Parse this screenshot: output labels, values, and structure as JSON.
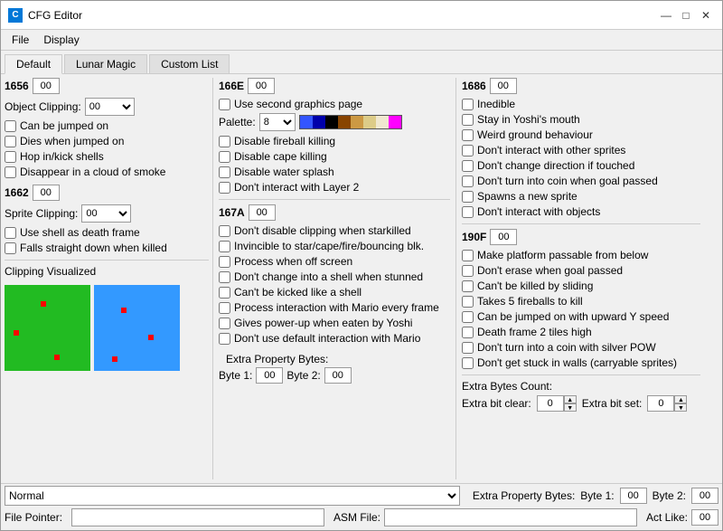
{
  "window": {
    "title": "CFG Editor",
    "icon": "C"
  },
  "titleControls": {
    "minimize": "—",
    "maximize": "□",
    "close": "✕"
  },
  "menuBar": {
    "items": [
      "File",
      "Display"
    ]
  },
  "tabs": {
    "items": [
      "Default",
      "Lunar Magic",
      "Custom List"
    ],
    "active": 0
  },
  "col1": {
    "hex1": {
      "label": "1656",
      "value": "00"
    },
    "objectClipping": {
      "label": "Object Clipping:",
      "value": "00"
    },
    "checkboxes1": [
      {
        "label": "Can be jumped on",
        "checked": false
      },
      {
        "label": "Dies when jumped on",
        "checked": false
      },
      {
        "label": "Hop in/kick shells",
        "checked": false
      },
      {
        "label": "Disappear in a cloud of smoke",
        "checked": false
      }
    ],
    "hex2": {
      "label": "1662",
      "value": "00"
    },
    "spriteClipping": {
      "label": "Sprite Clipping:",
      "value": "00"
    },
    "checkboxes2": [
      {
        "label": "Use shell as death frame",
        "checked": false
      },
      {
        "label": "Falls straight down when killed",
        "checked": false
      }
    ],
    "clippingLabel": "Clipping Visualized",
    "normalLabel": "Normal",
    "filePointerLabel": "File Pointer:",
    "asmFileLabel": "ASM File:"
  },
  "col2": {
    "hex1": {
      "label": "166E",
      "value": "00"
    },
    "checkboxUseSecond": {
      "label": "Use second graphics page",
      "checked": false
    },
    "palette": {
      "label": "Palette:",
      "value": "8",
      "colors": [
        "#3355ff",
        "#0000aa",
        "#000000",
        "#aa5500",
        "#d4a060",
        "#e8c880",
        "#f8f0d0",
        "#ff00ff"
      ]
    },
    "checkboxes": [
      {
        "label": "Disable fireball killing",
        "checked": false
      },
      {
        "label": "Disable cape killing",
        "checked": false
      },
      {
        "label": "Disable water splash",
        "checked": false
      },
      {
        "label": "Don't interact with Layer 2",
        "checked": false
      }
    ],
    "hex2": {
      "label": "167A",
      "value": "00"
    },
    "checkboxes2": [
      {
        "label": "Don't disable clipping when starkilled",
        "checked": false
      },
      {
        "label": "Invincible to star/cape/fire/bouncing blk.",
        "checked": false
      },
      {
        "label": "Process when off screen",
        "checked": false
      },
      {
        "label": "Don't change into a shell when stunned",
        "checked": false
      },
      {
        "label": "Can't be kicked like a shell",
        "checked": false
      },
      {
        "label": "Process interaction with Mario every frame",
        "checked": false
      },
      {
        "label": "Gives power-up when eaten by Yoshi",
        "checked": false
      },
      {
        "label": "Don't use default interaction with Mario",
        "checked": false
      }
    ],
    "extraPropertyLabel": "Extra Property Bytes:",
    "byte1Label": "Byte 1:",
    "byte1Value": "00",
    "byte2Label": "Byte 2:",
    "byte2Value": "00",
    "actLikeLabel": "Act Like:",
    "actLikeValue": "00"
  },
  "col3": {
    "hex1": {
      "label": "1686",
      "value": "00"
    },
    "checkboxes1": [
      {
        "label": "Inedible",
        "checked": false
      },
      {
        "label": "Stay in Yoshi's mouth",
        "checked": false
      },
      {
        "label": "Weird ground behaviour",
        "checked": false
      },
      {
        "label": "Don't interact with other sprites",
        "checked": false
      },
      {
        "label": "Don't change direction if touched",
        "checked": false
      },
      {
        "label": "Don't turn into coin when goal passed",
        "checked": false
      },
      {
        "label": "Spawns a new sprite",
        "checked": false
      },
      {
        "label": "Don't interact with objects",
        "checked": false
      }
    ],
    "hex2": {
      "label": "190F",
      "value": "00"
    },
    "checkboxes2": [
      {
        "label": "Make platform passable from below",
        "checked": false
      },
      {
        "label": "Don't erase when goal passed",
        "checked": false
      },
      {
        "label": "Can't be killed by sliding",
        "checked": false
      },
      {
        "label": "Takes 5 fireballs to kill",
        "checked": false
      },
      {
        "label": "Can be jumped on with upward Y speed",
        "checked": false
      },
      {
        "label": "Death frame 2 tiles high",
        "checked": false
      },
      {
        "label": "Don't turn into a coin with silver POW",
        "checked": false
      },
      {
        "label": "Don't get stuck in walls (carryable sprites)",
        "checked": false
      }
    ],
    "extraBytesLabel": "Extra Bytes Count:",
    "extraBitClearLabel": "Extra bit clear:",
    "extraBitClearValue": "0",
    "extraBitSetLabel": "Extra bit set:",
    "extraBitSetValue": "0"
  },
  "palette": {
    "colors": [
      "#3366ff",
      "#0000bb",
      "#000000",
      "#884400",
      "#bb8833",
      "#ddbb77",
      "#eeddbb",
      "#ff00ff"
    ]
  }
}
